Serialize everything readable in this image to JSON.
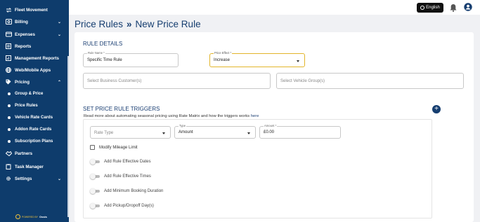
{
  "sidebar": {
    "items": [
      {
        "label": "Fleet Movement",
        "icon": "car-arrows-icon",
        "chevron": ""
      },
      {
        "label": "Billing",
        "icon": "billing-icon",
        "chevron": "⌄"
      },
      {
        "label": "Expenses",
        "icon": "expenses-icon",
        "chevron": "⌄"
      },
      {
        "label": "Reports",
        "icon": "reports-icon",
        "chevron": ""
      },
      {
        "label": "Management Reports",
        "icon": "management-reports-icon",
        "chevron": ""
      },
      {
        "label": "Web/Mobile Apps",
        "icon": "globe-icon",
        "chevron": ""
      },
      {
        "label": "Pricing",
        "icon": "tag-icon",
        "chevron": "⌃"
      }
    ],
    "pricing_sub": [
      "Group & Price",
      "Price Rules",
      "Vehicle Rate Cards",
      "Addon Rate Cards",
      "Subscription Plans"
    ],
    "items_bottom": [
      {
        "label": "Partners",
        "icon": "handshake-icon",
        "chevron": ""
      },
      {
        "label": "Task Manager",
        "icon": "clipboard-icon",
        "chevron": ""
      },
      {
        "label": "Settings",
        "icon": "gear-icon",
        "chevron": "⌄"
      }
    ],
    "powered_by": "POWERED BY",
    "brand": "Ossis"
  },
  "topbar": {
    "language": "English",
    "icons": [
      "bell-icon",
      "user-avatar-icon"
    ]
  },
  "breadcrumb": {
    "parent": "Price Rules",
    "separator": "»",
    "current": "New Price Rule"
  },
  "rule_details": {
    "title": "RULE DETAILS",
    "rule_name_label": "Rule Name *",
    "rule_name_value": "Specific Time Rule",
    "price_effect_label": "Price Effect *",
    "price_effect_value": "Increase",
    "business_customers_placeholder": "Select Business Customer(s)",
    "vehicle_groups_placeholder": "Select Vehicle Group(s)"
  },
  "triggers": {
    "title": "SET PRICE RULE TRIGGERS",
    "help_text": "Read more about automating seasonal pricing using Rate Matrix and how the triggers works",
    "help_link": "here",
    "rate_type_placeholder": "Rate Type",
    "type_label": "Type",
    "type_value": "Amount",
    "amount_label": "Amount *",
    "amount_value": "£0.00",
    "modify_mileage_label": "Modify Mileage Limit",
    "toggles": [
      "Add Rule Effective Dates",
      "Add Rule Effective Times",
      "Add Minimum Booking Duration",
      "Add Pickup/Dropoff Day(s)"
    ]
  },
  "colors": {
    "sidebar_bg": "#0e3c6c",
    "accent": "#163e70",
    "focus_border": "#e2b52b"
  }
}
